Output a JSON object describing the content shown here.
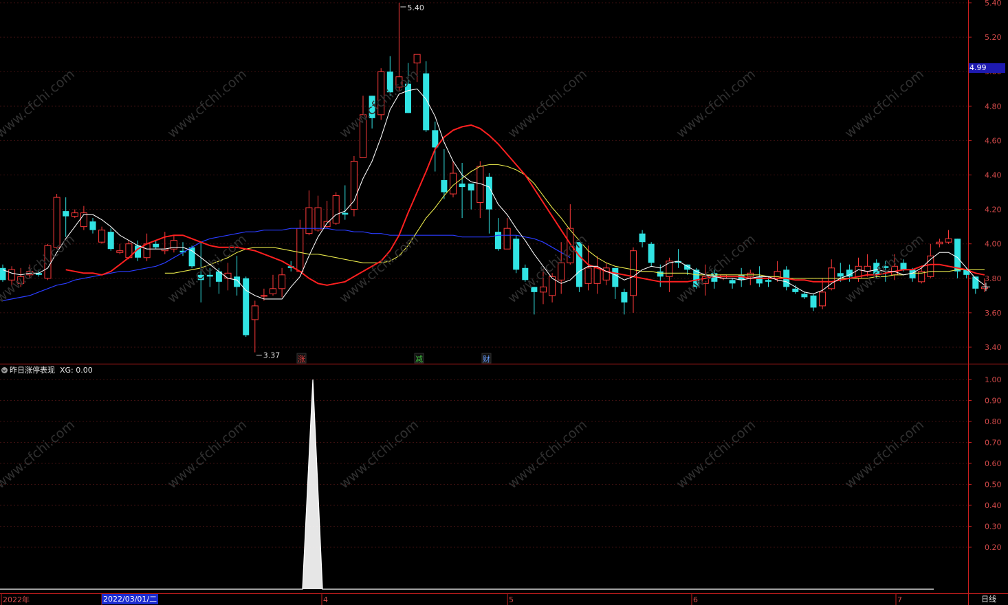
{
  "indicator": {
    "name": "昨日涨停表现",
    "value_label": "XG: 0.00"
  },
  "current_price_tag": "4.99",
  "cursor_date": "2022/03/01/二",
  "period": "日线",
  "watermark_text": "www.cfchi.com",
  "annotations": {
    "high_label": "5.40",
    "low_label": "3.37"
  },
  "event_markers": [
    {
      "label": "涨",
      "color": "#e04040"
    },
    {
      "label": "减",
      "color": "#40c040"
    },
    {
      "label": "财",
      "color": "#6aa0ff"
    }
  ],
  "axis": {
    "price_ticks": [
      "5.40",
      "5.20",
      "5.00",
      "4.80",
      "4.60",
      "4.40",
      "4.20",
      "4.00",
      "3.80",
      "3.60",
      "3.40"
    ],
    "indicator_ticks": [
      "1.00",
      "0.90",
      "0.80",
      "0.70",
      "0.60",
      "0.50",
      "0.40",
      "0.30",
      "0.20"
    ],
    "time_labels": [
      "2022年",
      "3",
      "4",
      "5",
      "6",
      "7"
    ]
  },
  "colors": {
    "up": "#ff3a3a",
    "down": "#31e3e3",
    "ma5": "#f5f5f5",
    "ma10": "#ff2020",
    "ma20": "#e6e64a",
    "ma60": "#2a3cff",
    "axis": "#c81e1e",
    "tick_text": "#d24a4a"
  },
  "chart_data": {
    "type": "candlestick",
    "price_range": [
      3.3,
      5.4
    ],
    "indicator_range": [
      0,
      1
    ],
    "candles": [
      [
        3.86,
        3.79,
        3.88,
        3.78
      ],
      [
        3.79,
        3.85,
        3.87,
        3.76
      ],
      [
        3.77,
        3.81,
        3.86,
        3.75
      ],
      [
        3.82,
        3.84,
        3.88,
        3.8
      ],
      [
        3.83,
        3.82,
        3.85,
        3.81
      ],
      [
        3.8,
        3.99,
        4.0,
        3.79
      ],
      [
        3.98,
        4.27,
        4.29,
        3.97
      ],
      [
        4.19,
        4.16,
        4.27,
        4.04
      ],
      [
        4.16,
        4.18,
        4.2,
        4.15
      ],
      [
        4.1,
        4.18,
        4.22,
        4.08
      ],
      [
        4.13,
        4.08,
        4.15,
        4.06
      ],
      [
        4.01,
        4.08,
        4.1,
        4.0
      ],
      [
        4.07,
        3.97,
        4.09,
        3.96
      ],
      [
        3.95,
        3.96,
        4.0,
        3.94
      ],
      [
        3.92,
        4.0,
        4.02,
        3.91
      ],
      [
        3.99,
        3.92,
        4.02,
        3.9
      ],
      [
        3.92,
        4.0,
        4.06,
        3.9
      ],
      [
        4.0,
        3.98,
        4.02,
        3.97
      ],
      [
        3.96,
        3.97,
        4.07,
        3.94
      ],
      [
        3.97,
        4.02,
        4.05,
        3.95
      ],
      [
        3.96,
        3.95,
        4.01,
        3.93
      ],
      [
        3.98,
        3.87,
        3.99,
        3.86
      ],
      [
        3.82,
        3.79,
        4.01,
        3.66
      ],
      [
        3.82,
        3.81,
        3.86,
        3.75
      ],
      [
        3.84,
        3.78,
        3.86,
        3.71
      ],
      [
        3.8,
        3.83,
        3.89,
        3.73
      ],
      [
        3.81,
        3.75,
        3.93,
        3.7
      ],
      [
        3.8,
        3.47,
        3.81,
        3.46
      ],
      [
        3.56,
        3.64,
        3.67,
        3.37
      ],
      [
        3.7,
        3.7,
        3.74,
        3.67
      ],
      [
        3.71,
        3.74,
        3.82,
        3.7
      ],
      [
        3.74,
        3.82,
        3.86,
        3.69
      ],
      [
        3.87,
        3.86,
        3.9,
        3.84
      ],
      [
        3.84,
        4.09,
        4.14,
        3.84
      ],
      [
        4.06,
        4.21,
        4.31,
        4.05
      ],
      [
        4.08,
        4.21,
        4.28,
        4.07
      ],
      [
        4.1,
        4.13,
        4.25,
        4.09
      ],
      [
        4.12,
        4.28,
        4.3,
        4.11
      ],
      [
        4.18,
        4.17,
        4.34,
        4.14
      ],
      [
        4.2,
        4.48,
        4.51,
        4.16
      ],
      [
        4.5,
        4.75,
        4.86,
        4.6
      ],
      [
        4.86,
        4.73,
        4.85,
        4.67
      ],
      [
        4.75,
        5.0,
        5.02,
        4.72
      ],
      [
        5.0,
        4.88,
        5.09,
        4.86
      ],
      [
        4.91,
        4.97,
        5.4,
        4.89
      ],
      [
        4.93,
        4.76,
        5.05,
        4.76
      ],
      [
        5.05,
        5.1,
        5.0,
        4.94
      ],
      [
        4.99,
        4.66,
        5.06,
        4.65
      ],
      [
        4.66,
        4.56,
        4.71,
        4.42
      ],
      [
        4.37,
        4.3,
        4.55,
        4.26
      ],
      [
        4.29,
        4.41,
        4.48,
        4.27
      ],
      [
        4.35,
        4.33,
        4.47,
        4.15
      ],
      [
        4.35,
        4.31,
        4.32,
        4.2
      ],
      [
        4.24,
        4.45,
        4.48,
        4.15
      ],
      [
        4.39,
        4.2,
        4.41,
        4.06
      ],
      [
        4.07,
        3.97,
        4.15,
        3.96
      ],
      [
        3.97,
        4.09,
        4.15,
        3.97
      ],
      [
        4.03,
        3.85,
        4.05,
        3.83
      ],
      [
        3.86,
        3.79,
        3.88,
        3.78
      ],
      [
        3.75,
        3.72,
        3.75,
        3.59
      ],
      [
        3.72,
        3.75,
        3.85,
        3.65
      ],
      [
        3.7,
        3.81,
        3.83,
        3.66
      ],
      [
        3.79,
        3.89,
        4.01,
        3.71
      ],
      [
        3.89,
        4.09,
        4.23,
        3.88
      ],
      [
        4.01,
        3.75,
        4.01,
        3.72
      ],
      [
        3.77,
        3.86,
        3.99,
        3.73
      ],
      [
        3.77,
        3.86,
        3.93,
        3.71
      ],
      [
        3.79,
        3.86,
        3.89,
        3.76
      ],
      [
        3.86,
        3.75,
        3.86,
        3.68
      ],
      [
        3.72,
        3.66,
        3.74,
        3.59
      ],
      [
        3.7,
        3.96,
        3.98,
        3.6
      ],
      [
        4.06,
        4.01,
        4.08,
        3.98
      ],
      [
        4.0,
        3.89,
        4.01,
        3.87
      ],
      [
        3.84,
        3.81,
        3.88,
        3.75
      ],
      [
        3.81,
        3.9,
        3.92,
        3.72
      ],
      [
        3.9,
        3.89,
        3.97,
        3.86
      ],
      [
        3.88,
        3.85,
        3.88,
        3.82
      ],
      [
        3.85,
        3.75,
        3.86,
        3.74
      ],
      [
        3.77,
        3.81,
        3.88,
        3.7
      ],
      [
        3.83,
        3.78,
        3.85,
        3.74
      ],
      [
        3.8,
        3.82,
        3.82,
        3.79
      ],
      [
        3.79,
        3.77,
        3.8,
        3.74
      ],
      [
        3.82,
        3.79,
        3.86,
        3.75
      ],
      [
        3.81,
        3.83,
        3.85,
        3.76
      ],
      [
        3.81,
        3.77,
        3.87,
        3.75
      ],
      [
        3.79,
        3.78,
        3.81,
        3.75
      ],
      [
        3.8,
        3.84,
        3.9,
        3.78
      ],
      [
        3.85,
        3.75,
        3.87,
        3.73
      ],
      [
        3.74,
        3.72,
        3.76,
        3.71
      ],
      [
        3.71,
        3.69,
        3.72,
        3.68
      ],
      [
        3.7,
        3.63,
        3.71,
        3.61
      ],
      [
        3.64,
        3.72,
        3.8,
        3.62
      ],
      [
        3.74,
        3.86,
        3.91,
        3.73
      ],
      [
        3.83,
        3.81,
        3.89,
        3.78
      ],
      [
        3.85,
        3.81,
        3.88,
        3.78
      ],
      [
        3.8,
        3.87,
        3.92,
        3.78
      ],
      [
        3.84,
        3.87,
        3.94,
        3.81
      ],
      [
        3.89,
        3.82,
        3.91,
        3.8
      ],
      [
        3.87,
        3.86,
        3.9,
        3.78
      ],
      [
        3.82,
        3.87,
        3.94,
        3.79
      ],
      [
        3.89,
        3.85,
        3.91,
        3.84
      ],
      [
        3.85,
        3.8,
        3.86,
        3.78
      ],
      [
        3.78,
        3.84,
        3.86,
        3.77
      ],
      [
        3.81,
        3.93,
        4.0,
        3.8
      ],
      [
        4.0,
        4.01,
        4.03,
        3.98
      ],
      [
        4.01,
        4.03,
        4.08,
        4.0
      ],
      [
        4.03,
        3.84,
        4.03,
        3.8
      ],
      [
        3.85,
        3.82,
        3.86,
        3.8
      ],
      [
        3.81,
        3.74,
        3.81,
        3.71
      ],
      [
        3.74,
        3.75,
        3.8,
        3.72
      ]
    ],
    "ma5": [
      3.85,
      3.83,
      3.82,
      3.83,
      3.83,
      3.86,
      3.95,
      4.03,
      4.1,
      4.17,
      4.17,
      4.14,
      4.1,
      4.05,
      4.02,
      3.99,
      3.97,
      3.97,
      3.97,
      3.98,
      3.98,
      3.96,
      3.92,
      3.88,
      3.84,
      3.8,
      3.79,
      3.73,
      3.7,
      3.68,
      3.68,
      3.68,
      3.75,
      3.81,
      3.93,
      4.04,
      4.12,
      4.17,
      4.19,
      4.25,
      4.38,
      4.48,
      4.62,
      4.78,
      4.87,
      4.89,
      4.9,
      4.84,
      4.74,
      4.59,
      4.48,
      4.4,
      4.36,
      4.35,
      4.33,
      4.23,
      4.17,
      4.09,
      4.02,
      3.94,
      3.87,
      3.8,
      3.77,
      3.79,
      3.84,
      3.87,
      3.87,
      3.84,
      3.82,
      3.79,
      3.81,
      3.85,
      3.87,
      3.86,
      3.89,
      3.9,
      3.87,
      3.84,
      3.82,
      3.81,
      3.8,
      3.8,
      3.79,
      3.8,
      3.81,
      3.81,
      3.79,
      3.78,
      3.75,
      3.72,
      3.71,
      3.73,
      3.77,
      3.8,
      3.82,
      3.85,
      3.84,
      3.85,
      3.84,
      3.84,
      3.82,
      3.83,
      3.86,
      3.91,
      3.95,
      3.95,
      3.92,
      3.86,
      3.8,
      3.76
    ],
    "ma10": [
      3.85,
      3.84,
      3.83,
      3.83,
      3.82,
      3.84,
      3.88,
      3.92,
      3.97,
      4.0,
      4.02,
      4.04,
      4.05,
      4.05,
      4.03,
      4.01,
      3.99,
      3.98,
      3.98,
      3.98,
      3.97,
      3.96,
      3.94,
      3.92,
      3.9,
      3.87,
      3.84,
      3.8,
      3.77,
      3.76,
      3.77,
      3.78,
      3.81,
      3.84,
      3.87,
      3.9,
      3.96,
      4.05,
      4.18,
      4.3,
      4.42,
      4.55,
      4.62,
      4.66,
      4.68,
      4.69,
      4.67,
      4.63,
      4.58,
      4.52,
      4.46,
      4.4,
      4.32,
      4.24,
      4.16,
      4.08,
      4.0,
      3.93,
      3.88,
      3.86,
      3.84,
      3.83,
      3.82,
      3.81,
      3.8,
      3.79,
      3.78,
      3.78,
      3.78,
      3.78,
      3.79,
      3.8,
      3.81,
      3.81,
      3.81,
      3.81,
      3.8,
      3.8,
      3.8,
      3.8,
      3.8,
      3.79,
      3.79,
      3.78,
      3.78,
      3.78,
      3.79,
      3.8,
      3.81,
      3.82,
      3.82,
      3.83,
      3.84,
      3.85,
      3.85,
      3.87,
      3.88,
      3.88,
      3.87,
      3.86,
      3.85,
      3.83,
      3.82
    ],
    "ma20": [
      3.83,
      3.83,
      3.84,
      3.85,
      3.86,
      3.88,
      3.9,
      3.92,
      3.95,
      3.97,
      3.98,
      3.98,
      3.98,
      3.97,
      3.96,
      3.95,
      3.94,
      3.94,
      3.93,
      3.92,
      3.91,
      3.9,
      3.89,
      3.89,
      3.89,
      3.9,
      3.93,
      3.99,
      4.07,
      4.15,
      4.21,
      4.28,
      4.34,
      4.38,
      4.42,
      4.45,
      4.46,
      4.46,
      4.45,
      4.43,
      4.4,
      4.35,
      4.28,
      4.21,
      4.15,
      4.08,
      4.02,
      3.96,
      3.92,
      3.89,
      3.87,
      3.86,
      3.85,
      3.84,
      3.84,
      3.83,
      3.83,
      3.83,
      3.83,
      3.82,
      3.82,
      3.82,
      3.82,
      3.82,
      3.82,
      3.82,
      3.82,
      3.81,
      3.81,
      3.8,
      3.8,
      3.8,
      3.8,
      3.8,
      3.8,
      3.8,
      3.8,
      3.8,
      3.8,
      3.81,
      3.81,
      3.82,
      3.82,
      3.83,
      3.83,
      3.84,
      3.84,
      3.84,
      3.85,
      3.85,
      3.85,
      3.85
    ],
    "ma60": [
      3.67,
      3.68,
      3.69,
      3.7,
      3.72,
      3.74,
      3.76,
      3.77,
      3.79,
      3.8,
      3.81,
      3.82,
      3.83,
      3.84,
      3.84,
      3.85,
      3.86,
      3.87,
      3.89,
      3.92,
      3.95,
      3.98,
      4.01,
      4.03,
      4.04,
      4.05,
      4.06,
      4.07,
      4.07,
      4.08,
      4.08,
      4.08,
      4.09,
      4.09,
      4.09,
      4.09,
      4.09,
      4.08,
      4.08,
      4.07,
      4.07,
      4.06,
      4.06,
      4.05,
      4.05,
      4.05,
      4.05,
      4.05,
      4.05,
      4.05,
      4.05,
      4.04,
      4.04,
      4.04,
      4.04,
      4.05,
      4.05,
      4.05,
      4.04,
      4.03,
      4.01,
      3.98,
      3.95,
      3.92
    ],
    "xg_series": [
      0,
      0,
      1,
      0,
      0
    ]
  }
}
